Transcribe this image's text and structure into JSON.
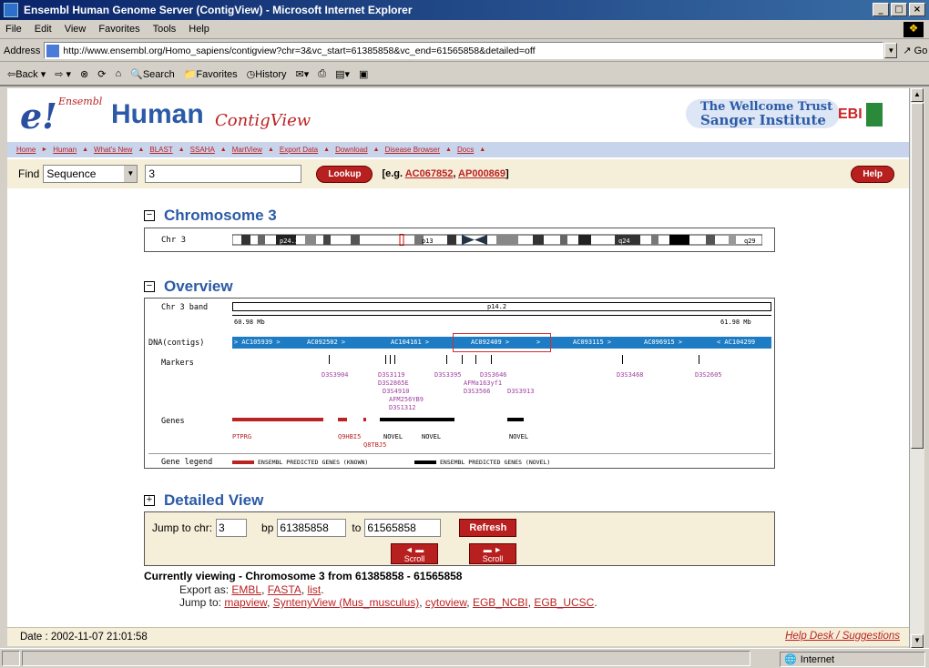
{
  "window": {
    "title": "Ensembl Human Genome Server (ContigView) - Microsoft Internet Explorer",
    "controls": [
      "_",
      "□",
      "×"
    ]
  },
  "menu": [
    "File",
    "Edit",
    "View",
    "Favorites",
    "Tools",
    "Help"
  ],
  "address": {
    "label": "Address",
    "url": "http://www.ensembl.org/Homo_sapiens/contigview?chr=3&vc_start=61385858&vc_end=61565858&detailed=off",
    "go": "Go"
  },
  "toolbar": {
    "back": "⇦Back ▾",
    "forward": "⇨ ▾",
    "stop": "⊗",
    "refresh": "⟳",
    "home": "⌂",
    "search": "Search",
    "favorites": "Favorites",
    "history": "History"
  },
  "header": {
    "logo": "e!",
    "logo_small": "Ensembl",
    "species": "Human",
    "view": "ContigView",
    "sanger_1": "The Wellcome Trust",
    "sanger_2": "Sanger Institute",
    "ebi": "EBI"
  },
  "nav": [
    "Home",
    "Human",
    "What's New",
    "BLAST",
    "SSAHA",
    "MartView",
    "Export Data",
    "Download",
    "Disease Browser",
    "Docs"
  ],
  "find": {
    "label": "Find",
    "type": "Sequence",
    "value": "3",
    "lookup": "Lookup",
    "eg_prefix": "[e.g.",
    "eg1": "AC067852",
    "eg_sep": ",",
    "eg2": "AP000869",
    "eg_suffix": "]",
    "help": "Help"
  },
  "chromosome": {
    "title": "Chromosome 3",
    "label": "Chr 3",
    "bands": [
      "p24.3",
      "p13",
      "q24",
      "q29"
    ]
  },
  "overview": {
    "title": "Overview",
    "band_label": "Chr 3 band",
    "band": "p14.2",
    "start": "60.98 Mb",
    "end": "61.98 Mb",
    "dna_label": "DNA(contigs)",
    "contigs": [
      "> AC105939 >",
      "AC092502 >",
      "AC104161 >",
      "AC092409 >",
      ">",
      "AC093115 >",
      "AC096915 >",
      "< AC104299"
    ],
    "markers_label": "Markers",
    "markers": [
      "D3S3904",
      "D3S3119",
      "D3S2865E",
      "D3S4910",
      "AFM256YB9",
      "D3S1312",
      "D3S3395",
      "D3S3646",
      "AFMa163yf1",
      "D3S3566",
      "D3S3913",
      "D3S3468",
      "D3S2605"
    ],
    "genes_label": "Genes",
    "genes": [
      "PTPRG",
      "Q9HBI5",
      "Q8TBJ5",
      "NOVEL",
      "NOVEL",
      "NOVEL"
    ],
    "legend_label": "Gene legend",
    "legend_known": "ENSEMBL PREDICTED GENES (KNOWN)",
    "legend_novel": "ENSEMBL PREDICTED GENES (NOVEL)"
  },
  "detailed": {
    "title": "Detailed View",
    "jump_label": "Jump to chr:",
    "chr": "3",
    "bp_label": "bp",
    "bp_from": "61385858",
    "to_label": "to",
    "bp_to": "61565858",
    "refresh": "Refresh",
    "scroll_left": "◄ ▬",
    "scroll_right": "▬ ►",
    "scroll": "Scroll"
  },
  "current": "Currently viewing - Chromosome 3 from 61385858 - 61565858",
  "export": {
    "label": "Export as:",
    "links": [
      "EMBL",
      "FASTA",
      "list"
    ],
    "jump_label": "Jump to:",
    "jump_links": [
      "mapview",
      "SyntenyView (Mus_musculus)",
      "cytoview",
      "EGB_NCBI",
      "EGB_UCSC"
    ]
  },
  "footer": {
    "date": "Date : 2002-11-07 21:01:58",
    "help": "Help Desk / Suggestions"
  },
  "status": {
    "zone": "Internet"
  },
  "colors": {
    "title_bar": "#0a246a",
    "ensembl_blue": "#2b5aa6",
    "ensembl_red": "#b22222",
    "contig_blue": "#1e7cc4",
    "find_bg": "#f5eed8"
  }
}
